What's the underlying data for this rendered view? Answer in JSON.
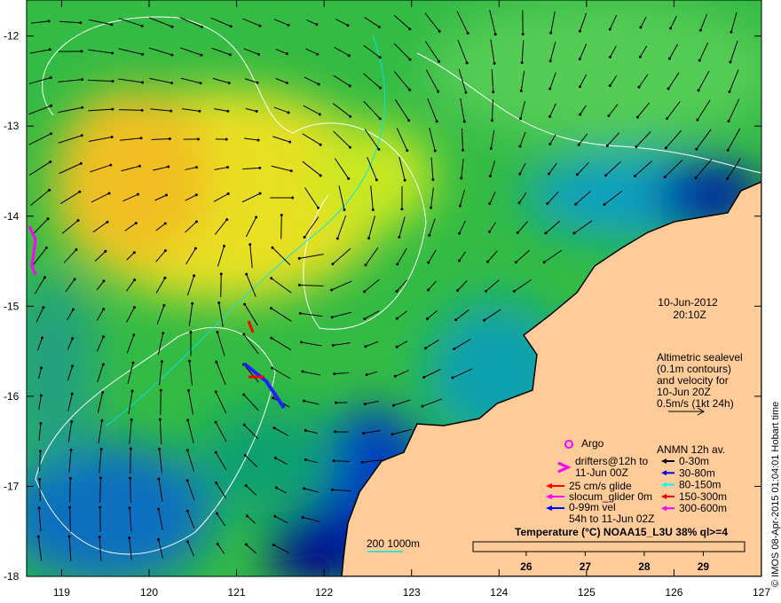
{
  "map": {
    "date": "10-Jun-2012",
    "time": "20:10Z",
    "altimetry_note": [
      "Altimetric sealevel",
      "(0.1m contours)",
      "and velocity for",
      "10-Jun 20Z",
      "0.5m/s (1kt 24h)"
    ],
    "lat_ticks": [
      "-12",
      "-13",
      "-14",
      "-15",
      "-16",
      "-17",
      "-18"
    ],
    "lon_ticks": [
      "119",
      "120",
      "121",
      "122",
      "123",
      "124",
      "125",
      "126",
      "127"
    ],
    "lat_range": [
      -18,
      -11.6
    ],
    "lon_range": [
      118.6,
      127
    ],
    "land_color": "#ffcc99",
    "credit": "© IMOS 08-Apr-2015 01:04:01 Hobart time",
    "scale_bar": "200  1000m",
    "scale_bar_color": "#00e5e5"
  },
  "legend": {
    "argo": "Argo",
    "drifters": [
      "drifters@12h to",
      "11-Jun 00Z"
    ],
    "glide": "25 cm/s glide",
    "slocum": "slocum_glider 0m",
    "vel": [
      "0-99m vel",
      "54h to 11-Jun 02Z"
    ],
    "anmn_title": "ANMN 12h av.",
    "anmn": [
      {
        "label": "0-30m",
        "color": "#000000"
      },
      {
        "label": "30-80m",
        "color": "#0000ff"
      },
      {
        "label": "80-150m",
        "color": "#00ffff"
      },
      {
        "label": "150-300m",
        "color": "#ff0000"
      },
      {
        "label": "300-600m",
        "color": "#ff00ff"
      }
    ]
  },
  "colorbar": {
    "title": "Temperature (°C) NOAA15_L3U 38% ql>=4",
    "ticks": [
      "26",
      "27",
      "28",
      "29"
    ],
    "range": [
      25.1,
      29.7
    ],
    "colors": [
      "#000080",
      "#0050e0",
      "#00b0ff",
      "#00d0a0",
      "#00c040",
      "#00d000",
      "#b0ff00",
      "#f0e000",
      "#ffb000",
      "#e07000",
      "#c04000",
      "#a00000"
    ]
  }
}
